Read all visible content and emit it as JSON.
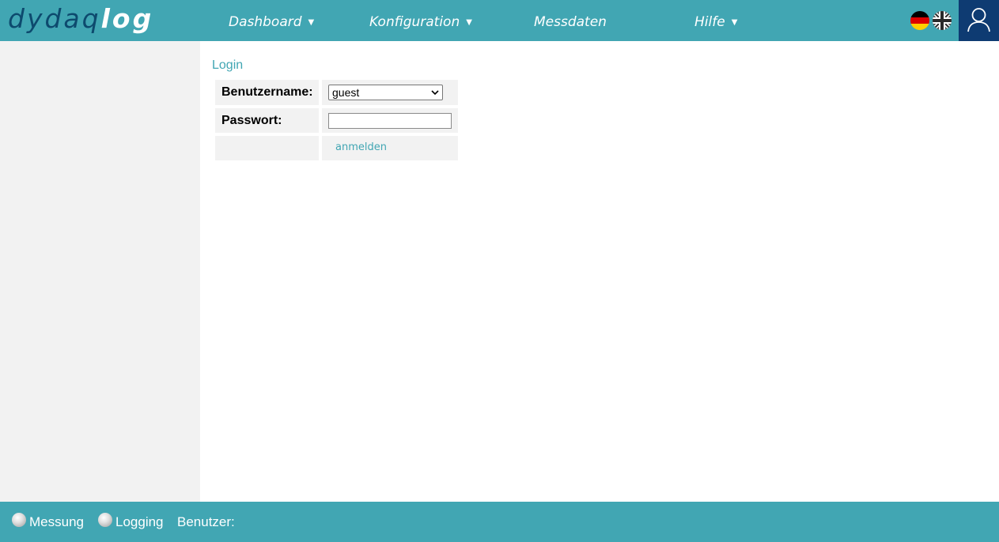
{
  "header": {
    "logo_part1": "dydaq",
    "logo_part2": "log",
    "nav": [
      {
        "label": "Dashboard",
        "caret": "▼"
      },
      {
        "label": "Konfiguration",
        "caret": "▼"
      },
      {
        "label": "Messdaten"
      },
      {
        "label": "Hilfe",
        "caret": "▼"
      }
    ],
    "flags": [
      "german-flag-icon",
      "uk-flag-icon"
    ],
    "user_icon": "user-icon"
  },
  "login": {
    "title": "Login",
    "username_label": "Benutzername:",
    "username_value": "guest",
    "password_label": "Passwort:",
    "password_value": "",
    "submit_label": "anmelden"
  },
  "footer": {
    "messung_label": "Messung",
    "logging_label": "Logging",
    "benutzer_label": "Benutzer:",
    "benutzer_value": ""
  },
  "colors": {
    "accent": "#41a6b3",
    "dark_blue": "#0e3b72",
    "sidebar_bg": "#f2f2f2"
  }
}
